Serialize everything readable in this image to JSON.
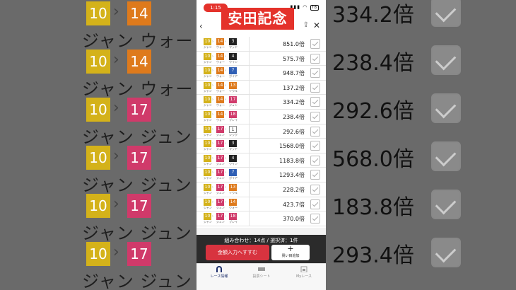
{
  "overlay": {
    "title": "安田記念"
  },
  "status": {
    "time": "1:15",
    "battery": "78"
  },
  "colors": {
    "h10": "#d4b21a",
    "h14": "#de7a1c",
    "h17": "#d03a6a",
    "h1": "#ffffff",
    "h3": "#222222",
    "h4": "#222222",
    "h7": "#2f5fb5",
    "h13": "#de7a1c",
    "h18": "#d03a6a",
    "accent": "#d8333f"
  },
  "rows": [
    {
      "h": [
        {
          "n": "10",
          "nm": "ジャン",
          "c": "h10"
        },
        {
          "n": "14",
          "nm": "ウォー",
          "c": "h14"
        },
        {
          "n": "3",
          "nm": "マッド",
          "c": "h3"
        }
      ],
      "odds": "851.0倍"
    },
    {
      "h": [
        {
          "n": "10",
          "nm": "ジャン",
          "c": "h10"
        },
        {
          "n": "14",
          "nm": "ウォー",
          "c": "h14"
        },
        {
          "n": "4",
          "nm": "ウイン",
          "c": "h4"
        }
      ],
      "odds": "575.7倍"
    },
    {
      "h": [
        {
          "n": "10",
          "nm": "ジャン",
          "c": "h10"
        },
        {
          "n": "14",
          "nm": "ウォー",
          "c": "h14"
        },
        {
          "n": "7",
          "nm": "ガイア",
          "c": "h7"
        }
      ],
      "odds": "948.7倍"
    },
    {
      "h": [
        {
          "n": "10",
          "nm": "ジャン",
          "c": "h10"
        },
        {
          "n": "14",
          "nm": "ウォー",
          "c": "h14"
        },
        {
          "n": "13",
          "nm": "ソウル",
          "c": "h13"
        }
      ],
      "odds": "137.2倍"
    },
    {
      "h": [
        {
          "n": "10",
          "nm": "ジャン",
          "c": "h10"
        },
        {
          "n": "14",
          "nm": "ウォー",
          "c": "h14"
        },
        {
          "n": "17",
          "nm": "ジュン",
          "c": "h17"
        }
      ],
      "odds": "334.2倍"
    },
    {
      "h": [
        {
          "n": "10",
          "nm": "ジャン",
          "c": "h10"
        },
        {
          "n": "14",
          "nm": "ウォー",
          "c": "h14"
        },
        {
          "n": "18",
          "nm": "ブレイ",
          "c": "h18"
        }
      ],
      "odds": "238.4倍"
    },
    {
      "h": [
        {
          "n": "10",
          "nm": "ジャン",
          "c": "h10"
        },
        {
          "n": "17",
          "nm": "ジュン",
          "c": "h17"
        },
        {
          "n": "1",
          "nm": "シック",
          "c": "h1"
        }
      ],
      "odds": "292.6倍"
    },
    {
      "h": [
        {
          "n": "10",
          "nm": "ジャン",
          "c": "h10"
        },
        {
          "n": "17",
          "nm": "ジュン",
          "c": "h17"
        },
        {
          "n": "3",
          "nm": "マッド",
          "c": "h3"
        }
      ],
      "odds": "1568.0倍"
    },
    {
      "h": [
        {
          "n": "10",
          "nm": "ジャン",
          "c": "h10"
        },
        {
          "n": "17",
          "nm": "ジュン",
          "c": "h17"
        },
        {
          "n": "4",
          "nm": "ウイン",
          "c": "h4"
        }
      ],
      "odds": "1183.8倍"
    },
    {
      "h": [
        {
          "n": "10",
          "nm": "ジャン",
          "c": "h10"
        },
        {
          "n": "17",
          "nm": "ジュン",
          "c": "h17"
        },
        {
          "n": "7",
          "nm": "ガイア",
          "c": "h7"
        }
      ],
      "odds": "1293.4倍"
    },
    {
      "h": [
        {
          "n": "10",
          "nm": "ジャン",
          "c": "h10"
        },
        {
          "n": "17",
          "nm": "ジュン",
          "c": "h17"
        },
        {
          "n": "13",
          "nm": "ソウル",
          "c": "h13"
        }
      ],
      "odds": "228.2倍"
    },
    {
      "h": [
        {
          "n": "10",
          "nm": "ジャン",
          "c": "h10"
        },
        {
          "n": "17",
          "nm": "ジュン",
          "c": "h17"
        },
        {
          "n": "14",
          "nm": "ウォー",
          "c": "h14"
        }
      ],
      "odds": "423.7倍"
    },
    {
      "h": [
        {
          "n": "10",
          "nm": "ジャン",
          "c": "h10"
        },
        {
          "n": "17",
          "nm": "ジュン",
          "c": "h17"
        },
        {
          "n": "18",
          "nm": "ブレイ",
          "c": "h18"
        }
      ],
      "odds": "370.0倍"
    }
  ],
  "footer": {
    "summary": "組み合わせ：14点 / 選択済：1件",
    "amount_button": "金額入力へすすむ",
    "addcart_plus": "+",
    "addcart_label": "買い目追加"
  },
  "tabs": [
    {
      "label": "レース情報",
      "icon": "horseshoe-icon"
    },
    {
      "label": "投票シート",
      "icon": "ipat-icon"
    },
    {
      "label": "Myレース",
      "icon": "calendar-icon"
    }
  ],
  "bg_left": [
    {
      "n1": "10",
      "n2": "14",
      "txt": "ジャン ウォー ウ"
    },
    {
      "n1": "10",
      "n2": "14",
      "txt": "ジャン ウォー ブ"
    },
    {
      "n1": "10",
      "n2": "17",
      "txt": "ジャン ジュン シ"
    },
    {
      "n1": "10",
      "n2": "17",
      "txt": "ジャン ジュン マ"
    },
    {
      "n1": "10",
      "n2": "17",
      "txt": "ジャン ジュン ウ"
    },
    {
      "n1": "10",
      "n2": "17",
      "txt": "ジャン ジュン ガ"
    }
  ],
  "bg_right": [
    "334.2倍",
    "238.4倍",
    "292.6倍",
    "568.0倍",
    "183.8倍",
    "293.4倍"
  ]
}
